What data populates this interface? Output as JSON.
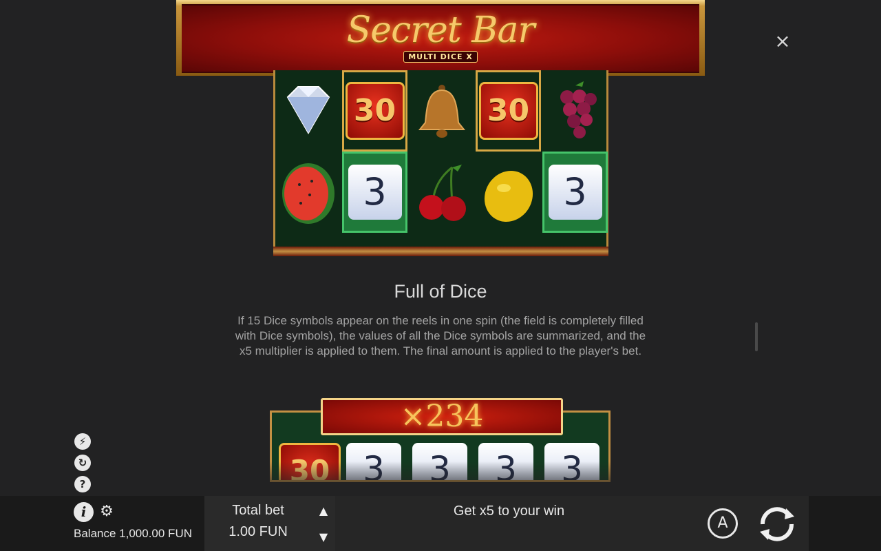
{
  "header": {
    "logo_title": "Secret Bar",
    "logo_subtitle": "MULTI DICE X",
    "close_label": "×"
  },
  "reels": {
    "row1": [
      "diamond",
      "30",
      "bell",
      "30",
      "grapes"
    ],
    "row2": [
      "watermelon",
      "3",
      "cherries",
      "lemon",
      "3"
    ],
    "tile_30": "30",
    "tile_3": "3"
  },
  "section": {
    "title": "Full of Dice",
    "body": "If 15 Dice symbols appear on the reels in one spin (the field is completely filled with Dice symbols), the values of all the Dice symbols are summarized, and the x5 multiplier is applied to them. The final amount is applied to the player's bet."
  },
  "example": {
    "multiplier": "×234",
    "tiles": [
      "30",
      "3",
      "3",
      "3",
      "3"
    ]
  },
  "bottom": {
    "balance": "Balance 1,000.00 FUN",
    "total_bet_label": "Total bet",
    "total_bet_value": "1.00 FUN",
    "win_message": "Get x5 to your win",
    "autoplay_label": "A"
  },
  "colors": {
    "background": "#222223",
    "gold": "#c39043",
    "red": "#b3140c",
    "green_highlight": "#1f7a3a"
  }
}
